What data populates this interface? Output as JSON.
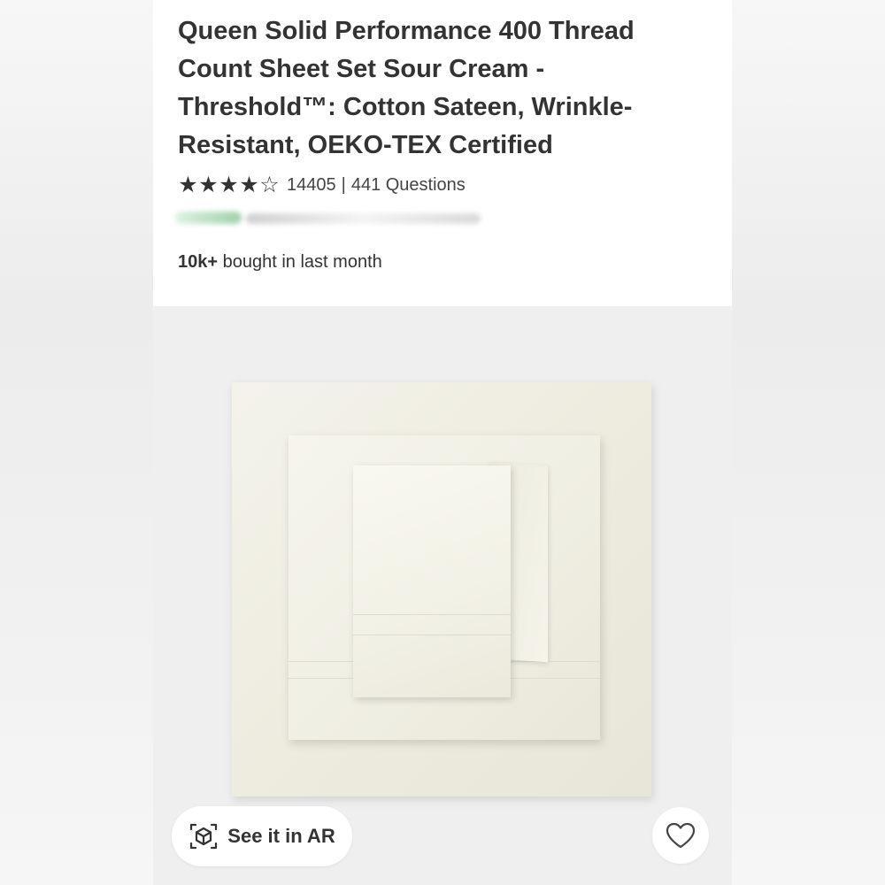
{
  "product": {
    "title": "Queen Solid Performance 400 Thread Count Sheet Set Sour Cream - Threshold™: Cotton Sateen, Wrinkle-Resistant, OEKO-TEX Certified",
    "rating_stars": 4,
    "rating_max": 5,
    "rating_count": "14405",
    "divider": "|",
    "questions": "441 Questions",
    "bought_bold": "10k+",
    "bought_rest": "bought in last month"
  },
  "image_actions": {
    "ar_label": "See it in AR",
    "ar_icon": "ar-cube-icon",
    "favorite_icon": "heart-icon"
  },
  "colors": {
    "text": "#333333",
    "sheet": "#efeee2"
  }
}
